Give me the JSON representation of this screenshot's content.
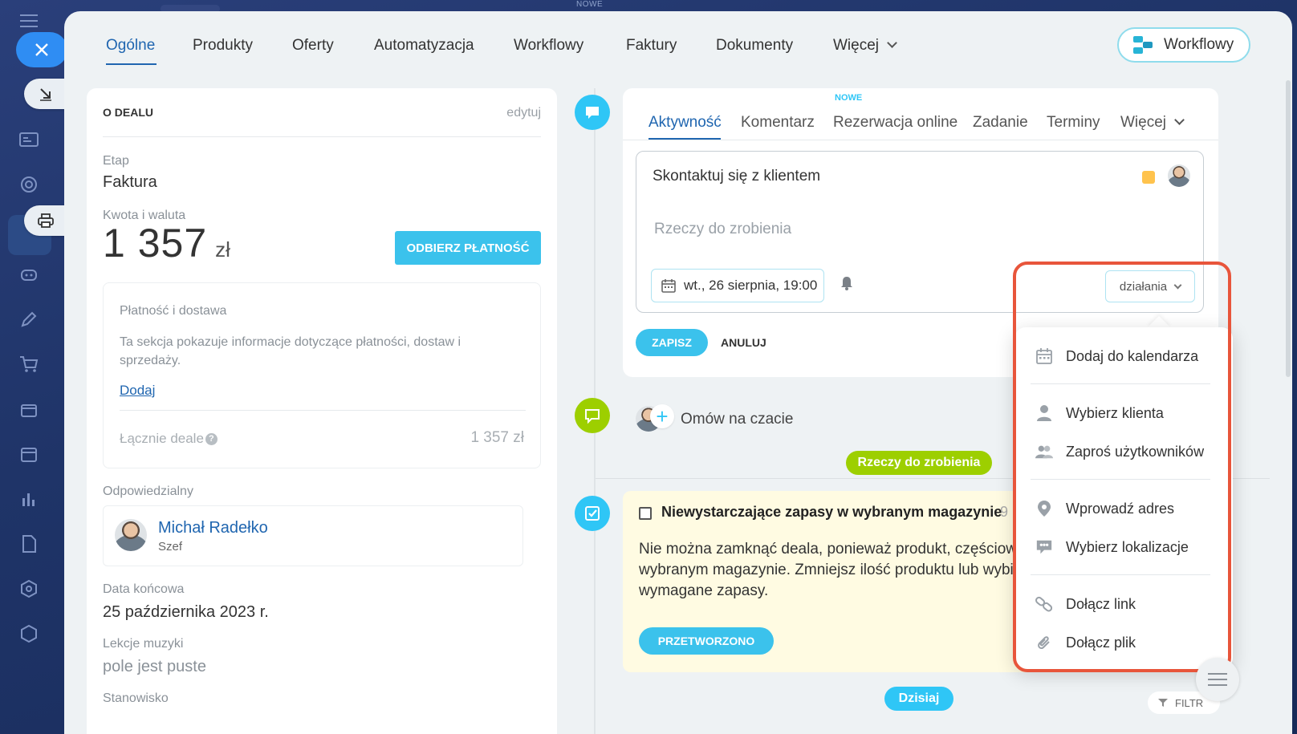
{
  "top": {
    "nowe_label": "NOWE"
  },
  "rail": {
    "close_icon": "close-icon",
    "icons": [
      "menu-icon",
      "download-icon",
      "contact-card-icon",
      "target-icon",
      "printer-icon",
      "crm-icon",
      "robot-icon",
      "pen-icon",
      "cart-icon",
      "store-icon",
      "calendar-icon",
      "chart-icon",
      "document-icon",
      "settings-icon",
      "box-icon"
    ]
  },
  "tabs": {
    "items": [
      "Ogólne",
      "Produkty",
      "Oferty",
      "Automatyzacja",
      "Workflowy",
      "Faktury",
      "Dokumenty",
      "Więcej"
    ],
    "active": "Ogólne",
    "workflow_button": "Workflowy"
  },
  "deal": {
    "header": "O DEALU",
    "edit_label": "edytuj",
    "stage_label": "Etap",
    "stage_value": "Faktura",
    "amount_label": "Kwota i waluta",
    "amount_value": "1 357",
    "amount_currency": "zł",
    "collect_button": "ODBIERZ PŁATNOŚĆ",
    "payment": {
      "title": "Płatność i dostawa",
      "description": "Ta sekcja pokazuje informacje dotyczące płatności, dostaw i sprzedaży.",
      "add_link": "Dodaj",
      "total_label": "Łącznie deale",
      "total_value": "1 357 zł"
    },
    "responsible_label": "Odpowiedzialny",
    "responsible_name": "Michał Radełko",
    "responsible_role": "Szef",
    "end_date_label": "Data końcowa",
    "end_date_value": "25 października 2023 r.",
    "music_label": "Lekcje muzyki",
    "music_value": "pole jest puste",
    "position_label": "Stanowisko"
  },
  "activity": {
    "tabs": [
      "Aktywność",
      "Komentarz",
      "Rezerwacja online",
      "Zadanie",
      "Terminy",
      "Więcej"
    ],
    "active": "Aktywność",
    "new_badge": "NOWE",
    "compose_title": "Skontaktuj się z klientem",
    "compose_placeholder": "Rzeczy do zrobienia",
    "date": "wt., 26 sierpnia, 19:00",
    "actions_button": "działania",
    "save_button": "ZAPISZ",
    "cancel_button": "ANULUJ",
    "accent_color": "#ffc34d"
  },
  "chat": {
    "label": "Omów na czacie"
  },
  "timeline": {
    "todo_pill": "Rzeczy do zrobienia",
    "today_pill": "Dzisiaj",
    "filter_label": "FILTR"
  },
  "task": {
    "title": "Niewystarczające zapasy w wybranym magazynie",
    "number": "9",
    "description": "Nie można zamknąć deala, ponieważ produkt, częściowo nie jest dostępny w wybranym magazynie. Zmniejsz ilość produktu lub wybierz magazyn, który posiada wymagane zapasy.",
    "processed_button": "PRZETWORZONO"
  },
  "dropdown": {
    "items": [
      {
        "label": "Dodaj do kalendarza",
        "icon": "calendar-icon"
      },
      {
        "label": "Wybierz klienta",
        "icon": "person-icon"
      },
      {
        "label": "Zaproś użytkowników",
        "icon": "people-icon"
      },
      {
        "label": "Wprowadź adres",
        "icon": "location-pin-icon"
      },
      {
        "label": "Wybierz lokalizacje",
        "icon": "location-chat-icon"
      },
      {
        "label": "Dołącz link",
        "icon": "link-icon"
      },
      {
        "label": "Dołącz plik",
        "icon": "paperclip-icon"
      }
    ]
  },
  "colors": {
    "accent": "#2fc6f6",
    "link": "#2066b0",
    "highlight": "#e8553b",
    "green": "#9dcf00"
  }
}
